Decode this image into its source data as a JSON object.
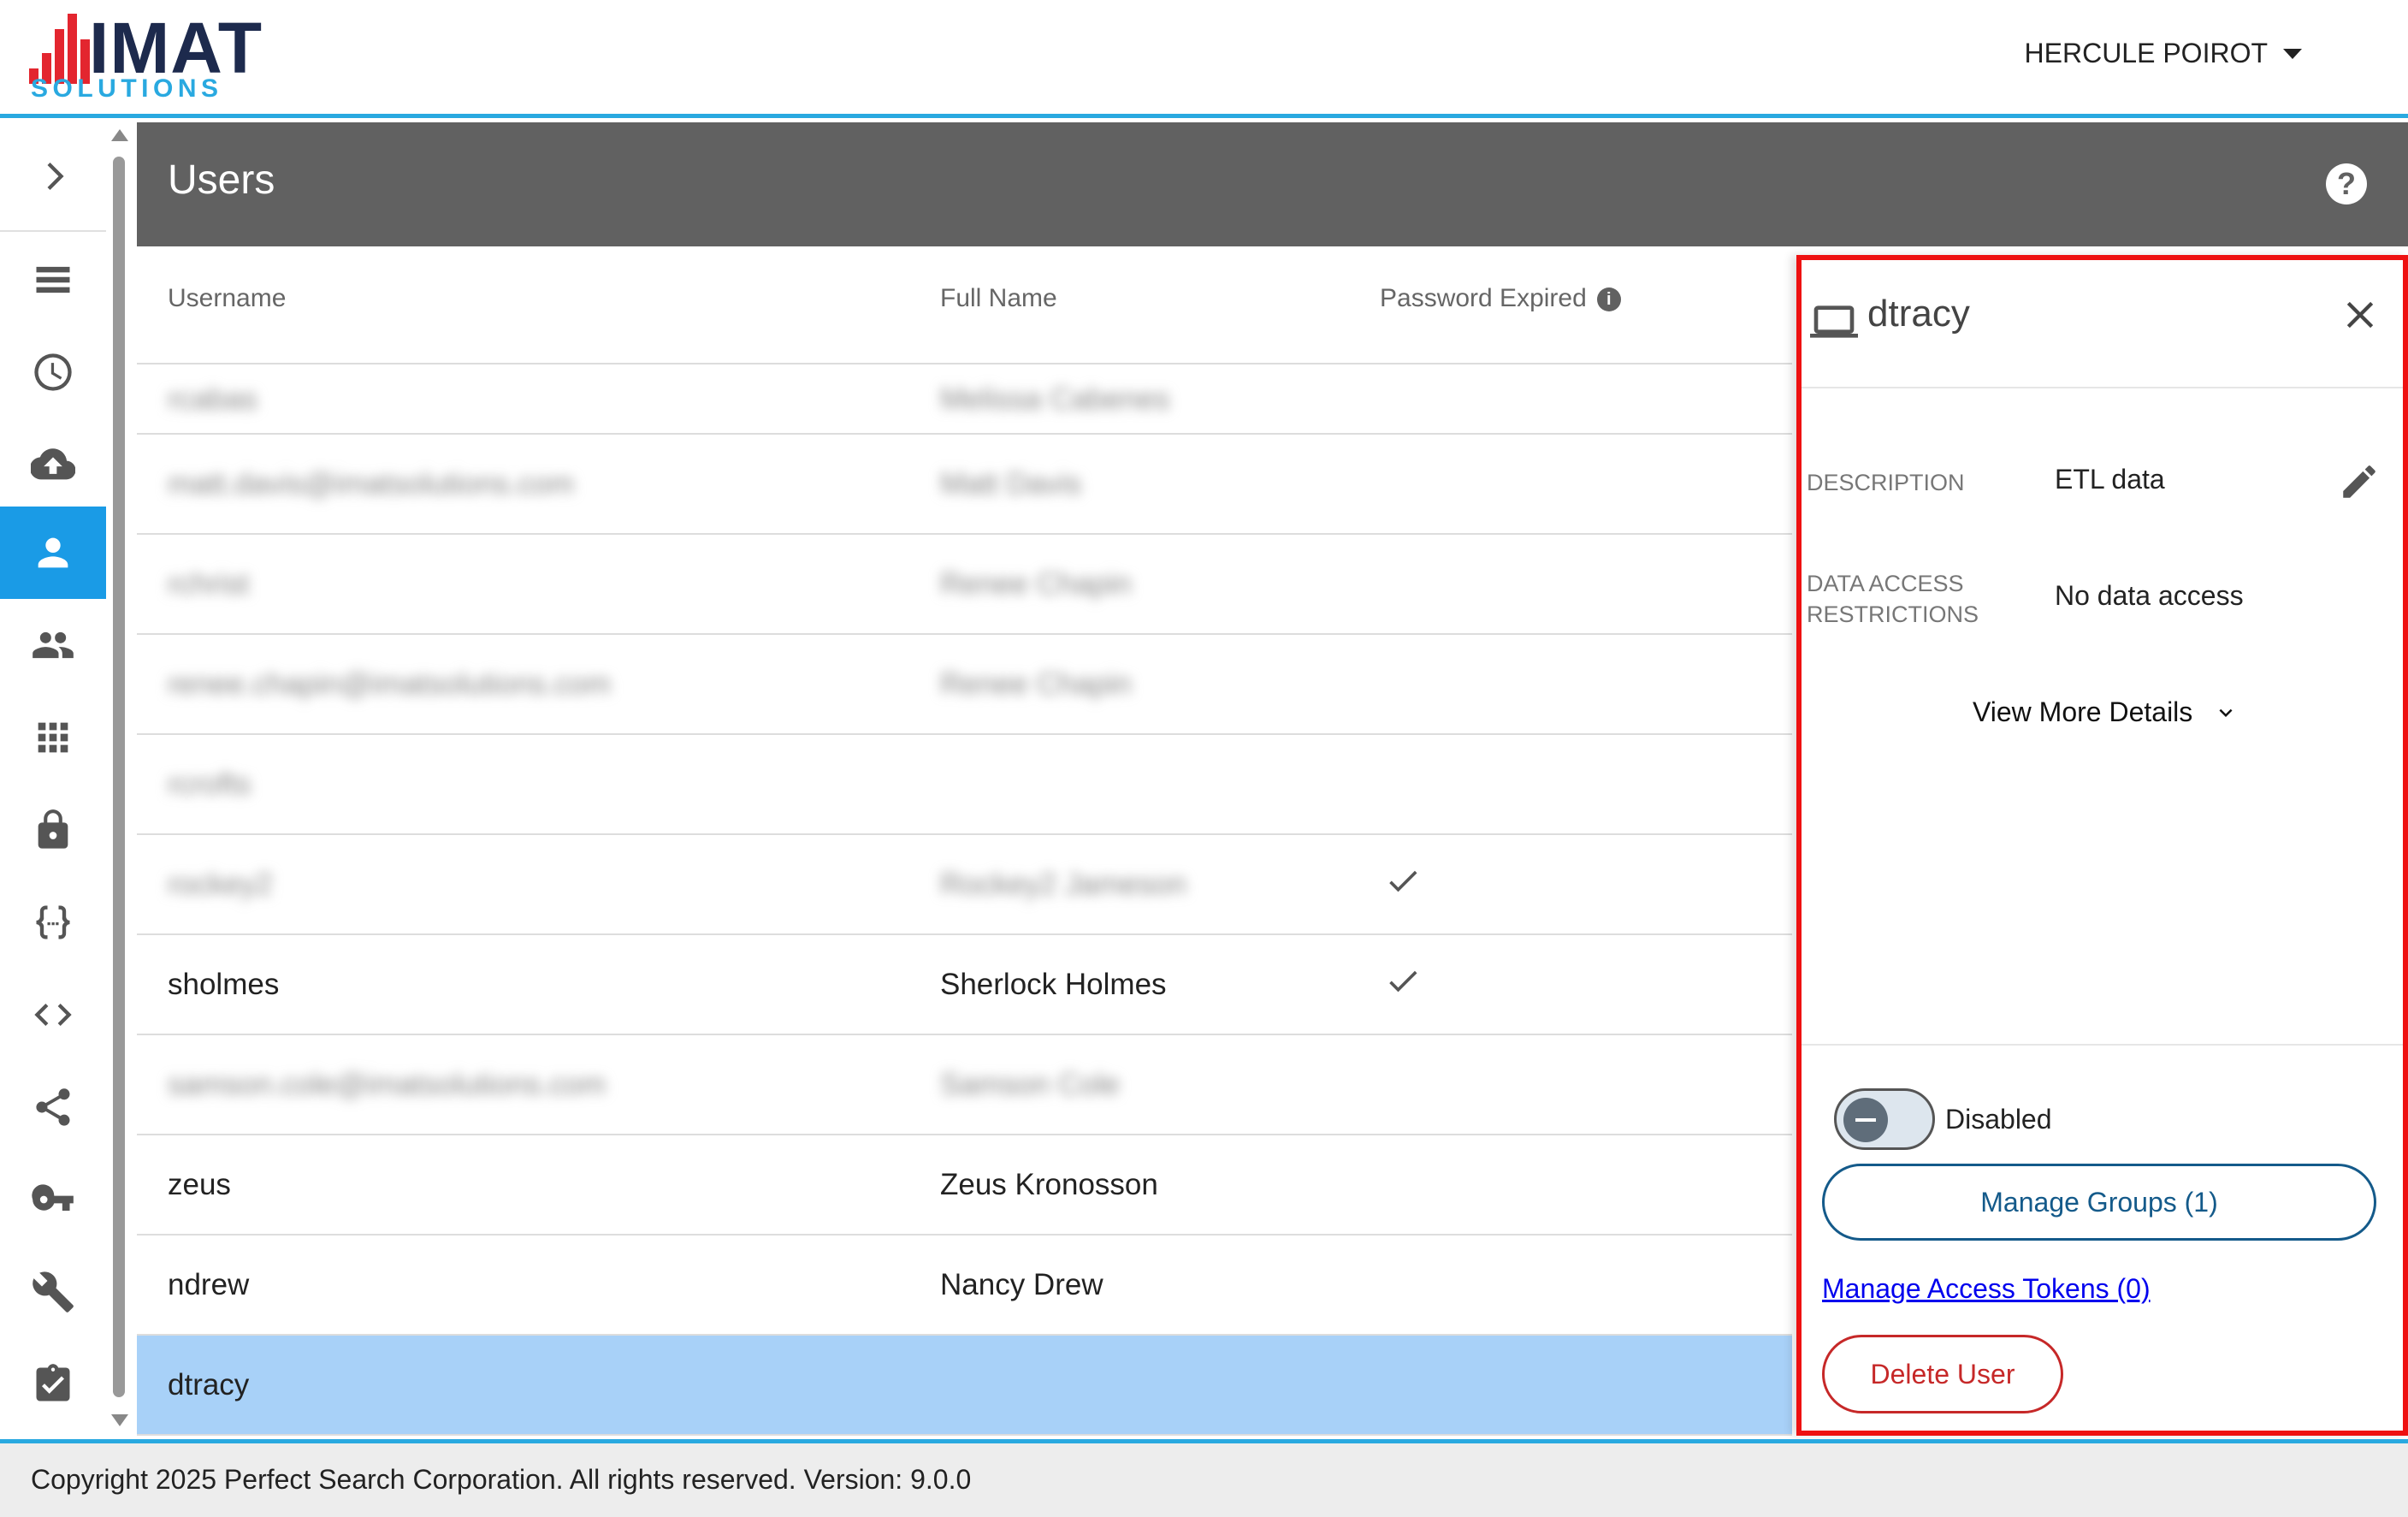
{
  "header": {
    "logo_top": "IMAT",
    "logo_bottom": "SOLUTIONS",
    "user_name": "HERCULE POIROT"
  },
  "nav": {
    "items": [
      {
        "name": "expand",
        "icon": "chevron-right-icon"
      },
      {
        "name": "list",
        "icon": "list-icon"
      },
      {
        "name": "history",
        "icon": "clock-icon"
      },
      {
        "name": "upload",
        "icon": "cloud-upload-icon"
      },
      {
        "name": "users",
        "icon": "person-icon",
        "active": true
      },
      {
        "name": "groups",
        "icon": "people-icon"
      },
      {
        "name": "apps",
        "icon": "grid-icon"
      },
      {
        "name": "security",
        "icon": "lock-icon"
      },
      {
        "name": "json",
        "icon": "curly-braces-icon"
      },
      {
        "name": "code",
        "icon": "code-icon"
      },
      {
        "name": "share",
        "icon": "share-icon"
      },
      {
        "name": "keys",
        "icon": "key-icon"
      },
      {
        "name": "tools",
        "icon": "wrench-icon"
      },
      {
        "name": "tasks",
        "icon": "clipboard-check-icon"
      }
    ]
  },
  "page": {
    "title": "Users"
  },
  "table": {
    "columns": [
      "Username",
      "Full Name",
      "Password Expired"
    ],
    "rows": [
      {
        "username": "rcabas",
        "full_name": "Melissa Cabenes",
        "password_expired": false,
        "blurred": true
      },
      {
        "username": "matt.davis@imatsolutions.com",
        "full_name": "Matt Davis",
        "password_expired": false,
        "blurred": true
      },
      {
        "username": "rchrist",
        "full_name": "Renee Chapin",
        "password_expired": false,
        "blurred": true
      },
      {
        "username": "renee.chapin@imatsolutions.com",
        "full_name": "Renee Chapin",
        "password_expired": false,
        "blurred": true
      },
      {
        "username": "rcrofts",
        "full_name": "",
        "password_expired": false,
        "blurred": true
      },
      {
        "username": "rockey2",
        "full_name": "Rockey2 Jameson",
        "password_expired": true,
        "blurred": true
      },
      {
        "username": "sholmes",
        "full_name": "Sherlock Holmes",
        "password_expired": true,
        "blurred": false
      },
      {
        "username": "samson.cole@imatsolutions.com",
        "full_name": "Samson Cole",
        "password_expired": false,
        "blurred": true
      },
      {
        "username": "zeus",
        "full_name": "Zeus Kronosson",
        "password_expired": false,
        "blurred": false
      },
      {
        "username": "ndrew",
        "full_name": "Nancy Drew",
        "password_expired": false,
        "blurred": false
      },
      {
        "username": "dtracy",
        "full_name": "",
        "password_expired": false,
        "blurred": false,
        "selected": true
      }
    ]
  },
  "panel": {
    "username": "dtracy",
    "description_label": "DESCRIPTION",
    "description_value": "ETL data",
    "restrictions_label_line1": "DATA ACCESS",
    "restrictions_label_line2": "RESTRICTIONS",
    "restrictions_value": "No data access",
    "view_more": "View More Details",
    "toggle_label": "Disabled",
    "toggle_on": false,
    "manage_groups": "Manage Groups (1)",
    "manage_tokens": "Manage Access Tokens (0)",
    "delete_user": "Delete User"
  },
  "footer": {
    "text": "Copyright 2025 Perfect Search Corporation. All rights reserved. Version: 9.0.0"
  },
  "colors": {
    "accent": "#29a9e0",
    "nav_active": "#1a9be6",
    "title_bar": "#616161",
    "selected_row": "#a8d1f8",
    "panel_outline": "#ee1111",
    "delete": "#c62828",
    "groups_button": "#145a8a"
  }
}
